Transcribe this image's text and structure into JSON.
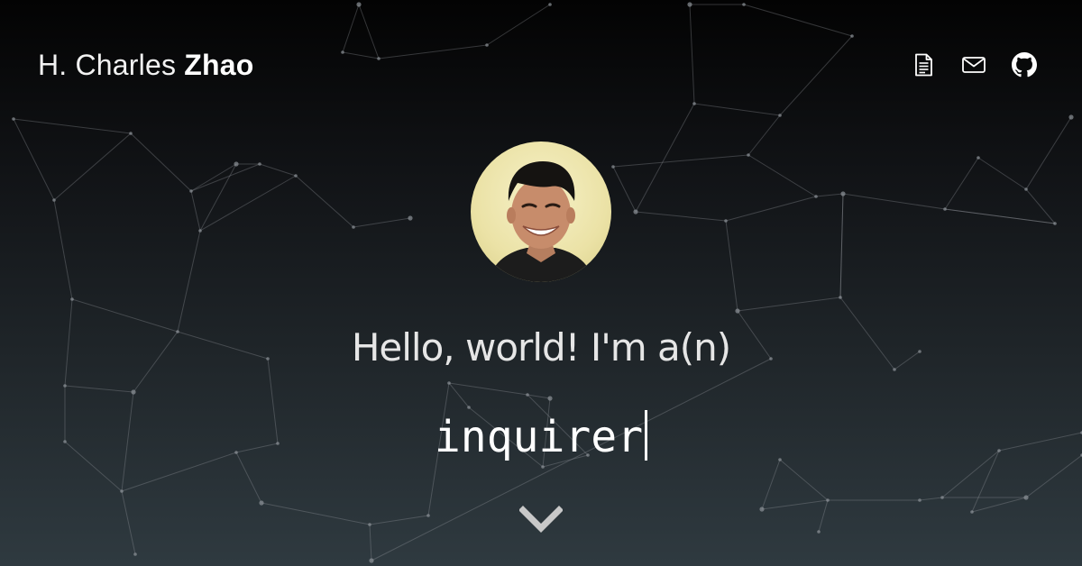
{
  "header": {
    "brand_first": "H. Charles",
    "brand_last": "Zhao"
  },
  "nav": {
    "icons": [
      "document-icon",
      "mail-icon",
      "github-icon"
    ]
  },
  "hero": {
    "greeting": "Hello, world! I'm a(n)",
    "typed_word": "inquirer"
  },
  "colors": {
    "background_top": "#030303",
    "background_bottom": "#2f3a40",
    "text": "#ffffff",
    "network_line": "#9aa0a6"
  }
}
